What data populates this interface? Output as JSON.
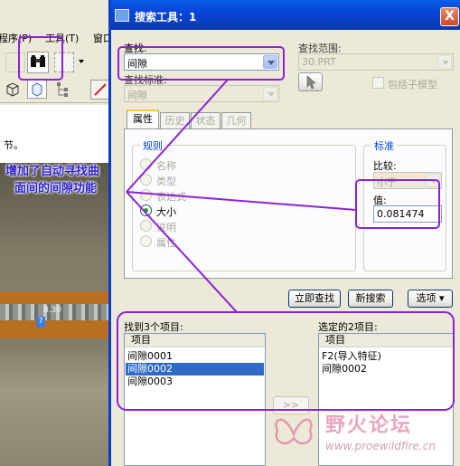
{
  "app": {
    "menu": [
      "程序(P)",
      "工具(T)",
      "窗口"
    ],
    "note_text": "节。",
    "part_label": "8.30"
  },
  "dialog": {
    "title": "搜索工具：1",
    "close_label": "X",
    "find_label": "查找:",
    "find_value": "间隙",
    "lookin_label": "查找范围:",
    "lookin_value": "30.PRT",
    "criteria_label": "查找标准:",
    "criteria_value": "间隙",
    "include_submodels_label": "包括子模型",
    "tabs": [
      "属性",
      "历史",
      "状态",
      "几何"
    ],
    "rules": {
      "title": "规则",
      "options": [
        "名称",
        "类型",
        "表达式",
        "大小",
        "说明",
        "属性"
      ],
      "selected": "大小"
    },
    "criteria_box": {
      "title": "标准",
      "compare_label": "比较:",
      "compare_value": "小于",
      "value_label": "值:",
      "value": "0.081474"
    },
    "buttons": {
      "find_now": "立即查找",
      "new_search": "新搜索",
      "options": "选项 ▾"
    },
    "found": {
      "label": "找到3个项目:",
      "header": "项目",
      "items": [
        "间隙0001",
        "间隙0002",
        "间隙0003"
      ],
      "selected_index": 1
    },
    "chosen": {
      "label": "选定的2项目:",
      "header": "项目",
      "items": [
        "F2(导入特征)",
        "间隙0002"
      ]
    },
    "move_button": ">>"
  },
  "annotation": {
    "lines": [
      "增加了自动寻找曲",
      "面间的间隙功能"
    ],
    "color": "#2b1fcf",
    "highlight_color": "#8b22d8"
  },
  "watermark": {
    "title": "野火论坛",
    "url": "www.proewildfire.cn"
  }
}
